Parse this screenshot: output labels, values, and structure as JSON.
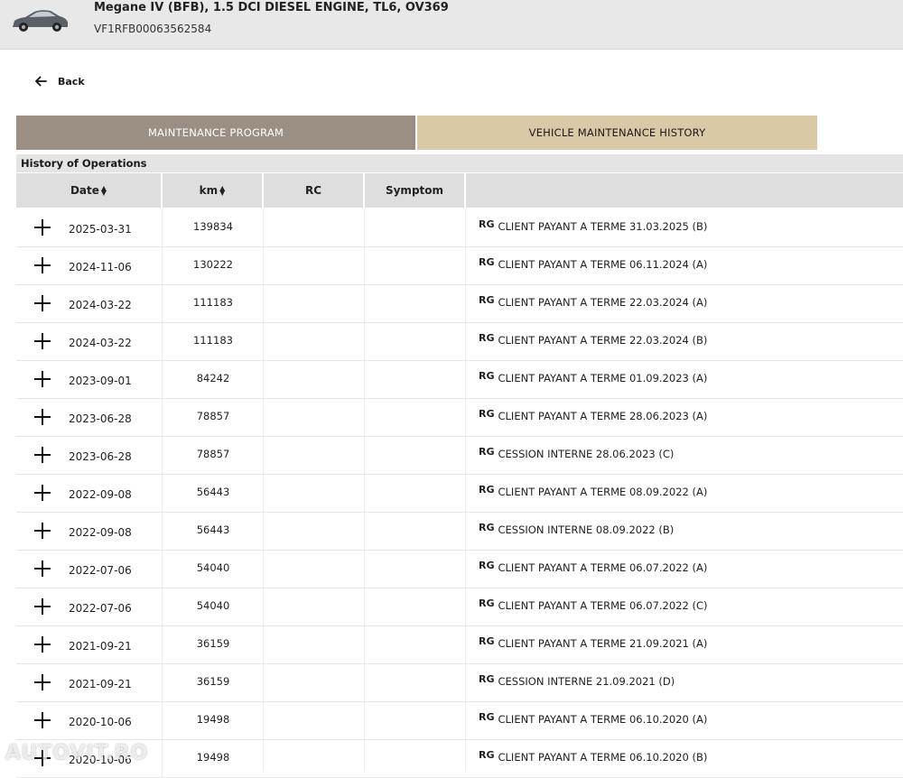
{
  "header": {
    "vehicle_title": "Megane IV (BFB), 1.5 DCI DIESEL ENGINE, TL6, OV369",
    "vin": "VF1RFB00063562584"
  },
  "nav": {
    "back_label": "Back"
  },
  "tabs": [
    {
      "label": "MAINTENANCE PROGRAM"
    },
    {
      "label": "VEHICLE MAINTENANCE HISTORY"
    }
  ],
  "section": {
    "title": "History of Operations"
  },
  "table": {
    "columns": [
      "Date",
      "km",
      "RC",
      "Symptom",
      ""
    ],
    "rows": [
      {
        "date": "2025-03-31",
        "km": "139834",
        "badge": "RG",
        "description": "CLIENT PAYANT A TERME 31.03.2025 (B)"
      },
      {
        "date": "2024-11-06",
        "km": "130222",
        "badge": "RG",
        "description": "CLIENT PAYANT A TERME 06.11.2024 (A)"
      },
      {
        "date": "2024-03-22",
        "km": "111183",
        "badge": "RG",
        "description": "CLIENT PAYANT A TERME 22.03.2024 (A)"
      },
      {
        "date": "2024-03-22",
        "km": "111183",
        "badge": "RG",
        "description": "CLIENT PAYANT A TERME 22.03.2024 (B)"
      },
      {
        "date": "2023-09-01",
        "km": "84242",
        "badge": "RG",
        "description": "CLIENT PAYANT A TERME 01.09.2023 (A)"
      },
      {
        "date": "2023-06-28",
        "km": "78857",
        "badge": "RG",
        "description": "CLIENT PAYANT A TERME 28.06.2023 (A)"
      },
      {
        "date": "2023-06-28",
        "km": "78857",
        "badge": "RG",
        "description": "CESSION INTERNE 28.06.2023 (C)"
      },
      {
        "date": "2022-09-08",
        "km": "56443",
        "badge": "RG",
        "description": "CLIENT PAYANT A TERME 08.09.2022 (A)"
      },
      {
        "date": "2022-09-08",
        "km": "56443",
        "badge": "RG",
        "description": "CESSION INTERNE 08.09.2022 (B)"
      },
      {
        "date": "2022-07-06",
        "km": "54040",
        "badge": "RG",
        "description": "CLIENT PAYANT A TERME 06.07.2022 (A)"
      },
      {
        "date": "2022-07-06",
        "km": "54040",
        "badge": "RG",
        "description": "CLIENT PAYANT A TERME 06.07.2022 (C)"
      },
      {
        "date": "2021-09-21",
        "km": "36159",
        "badge": "RG",
        "description": "CLIENT PAYANT A TERME 21.09.2021 (A)"
      },
      {
        "date": "2021-09-21",
        "km": "36159",
        "badge": "RG",
        "description": "CESSION INTERNE 21.09.2021 (D)"
      },
      {
        "date": "2020-10-06",
        "km": "19498",
        "badge": "RG",
        "description": "CLIENT PAYANT A TERME 06.10.2020 (A)"
      },
      {
        "date": "2020-10-06",
        "km": "19498",
        "badge": "RG",
        "description": "CLIENT PAYANT A TERME 06.10.2020 (B)"
      }
    ]
  },
  "watermark": "AUTOVIT.RO",
  "colors": {
    "tab_program_bg": "#9b8f84",
    "tab_history_bg": "#d9c9a6",
    "header_bg": "#e8e8e8"
  }
}
